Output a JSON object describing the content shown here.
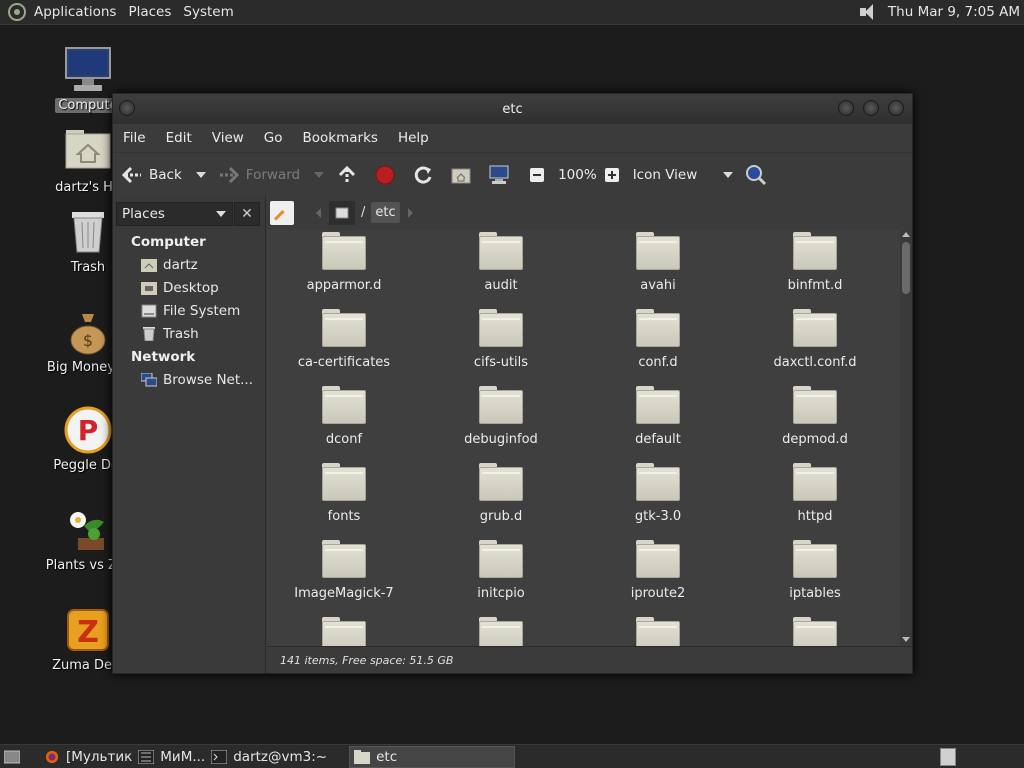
{
  "top_panel": {
    "menus": [
      "Applications",
      "Places",
      "System"
    ],
    "clock": "Thu Mar  9,  7:05 AM"
  },
  "desktop": {
    "icons": [
      {
        "label": "Compute",
        "name": "computer"
      },
      {
        "label": "dartz's Ho",
        "name": "home-folder"
      },
      {
        "label": "Trash",
        "name": "trash"
      },
      {
        "label": "Big Money D",
        "name": "big-money"
      },
      {
        "label": "Peggle Del",
        "name": "peggle"
      },
      {
        "label": "Plants vs Zor",
        "name": "plants-vs-zombies"
      },
      {
        "label": "Zuma Delu",
        "name": "zuma"
      }
    ]
  },
  "window": {
    "title": "etc",
    "menu": [
      "File",
      "Edit",
      "View",
      "Go",
      "Bookmarks",
      "Help"
    ],
    "toolbar": {
      "back": "Back",
      "forward": "Forward",
      "zoom": "100%",
      "view_mode": "Icon View"
    },
    "path": {
      "current": "etc",
      "separator": "/"
    },
    "sidebar": {
      "selector": "Places",
      "close": "✕",
      "computer_heading": "Computer",
      "computer_items": [
        "dartz",
        "Desktop",
        "File System",
        "Trash"
      ],
      "network_heading": "Network",
      "network_items": [
        "Browse Net..."
      ]
    },
    "files": [
      "apparmor.d",
      "audit",
      "avahi",
      "binfmt.d",
      "ca-certificates",
      "cifs-utils",
      "conf.d",
      "daxctl.conf.d",
      "dconf",
      "debuginfod",
      "default",
      "depmod.d",
      "fonts",
      "grub.d",
      "gtk-3.0",
      "httpd",
      "ImageMagick-7",
      "initcpio",
      "iproute2",
      "iptables",
      "",
      "",
      "",
      ""
    ],
    "status": "141 items, Free space: 51.5 GB"
  },
  "bottom_panel": {
    "tasks": [
      "[Мультик",
      "МиМ...",
      "dartz@vm3:~",
      "etc"
    ]
  },
  "colors": {
    "panel": "#2b2b2b",
    "window_bg": "#3b3b3b",
    "folder": "#d7d6c9",
    "desktop": "#1c1c1c"
  }
}
